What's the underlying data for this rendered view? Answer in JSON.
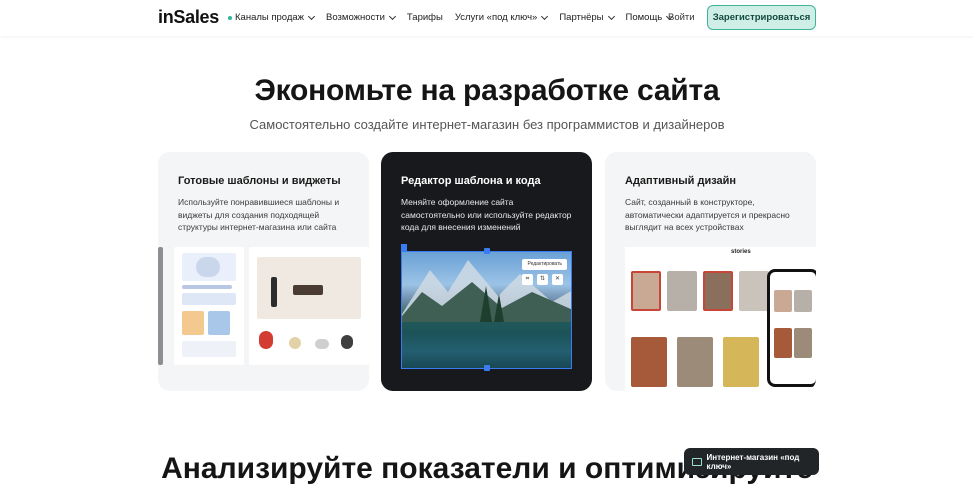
{
  "header": {
    "logo": "inSales",
    "nav": [
      {
        "label": "Каналы продаж",
        "dot": true
      },
      {
        "label": "Возможности",
        "dot": false
      },
      {
        "label": "Тарифы",
        "dot": false,
        "no_chevron": true
      },
      {
        "label": "Услуги «под ключ»",
        "dot": false
      },
      {
        "label": "Партнёры",
        "dot": false
      },
      {
        "label": "Помощь",
        "dot": false
      }
    ],
    "login": "Войти",
    "register": "Зарегистрироваться"
  },
  "hero": {
    "title": "Экономьте на разработке сайта",
    "subtitle": "Самостоятельно создайте интернет-магазин без программистов и дизайнеров"
  },
  "cards": [
    {
      "title": "Готовые шаблоны и виджеты",
      "text": "Используйте понравившиеся шаблоны и виджеты для создания подходящей структуры интернет-магазина или сайта"
    },
    {
      "title": "Редактор шаблона и кода",
      "text": "Меняйте оформление сайта самостоятельно или используйте редактор кода для внесения изменений",
      "editor_button": "Редактировать"
    },
    {
      "title": "Адаптивный дизайн",
      "text": "Сайт, созданный в конструкторе, автоматически адаптируется и прекрасно выглядит на всех устройствах",
      "brand": "stories"
    }
  ],
  "floating": {
    "label": "Интернет-магазин «под ключ»"
  },
  "bottom": {
    "title": "Анализируйте показатели и оптимизируйте"
  },
  "colors": {
    "accent": "#3fb39a",
    "accent_bg": "#cfeee6",
    "dark_card": "#17191c",
    "light_card": "#f4f5f6",
    "editor_frame": "#3b7cf2"
  }
}
